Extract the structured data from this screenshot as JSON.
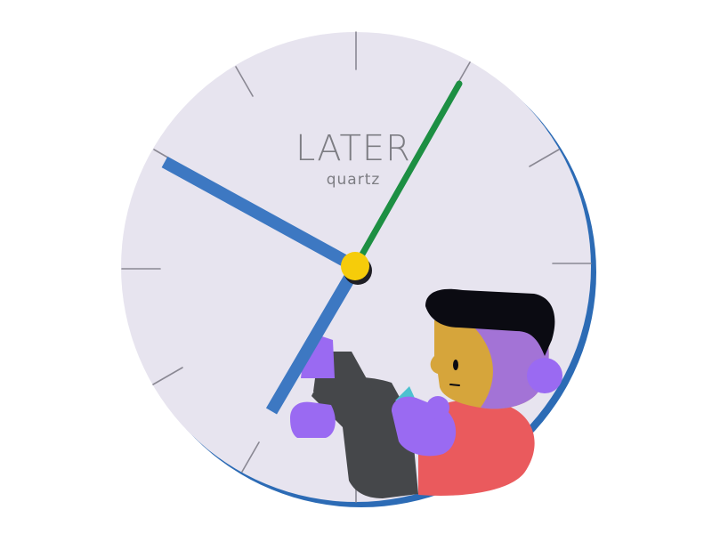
{
  "clock": {
    "brand": "LATER",
    "subtitle": "quartz"
  },
  "colors": {
    "face": "#e7e4ef",
    "rim_shadow": "#2c6bb5",
    "ticks": "#8a8893",
    "hour_minute_hands": "#3d78c2",
    "second_hand": "#1d8f43",
    "center_pin": "#f6cc0a",
    "brand_text": "#7d7d83",
    "hair": "#0b0b12",
    "skin": "#d6a53b",
    "hands_feet": "#9a6af2",
    "shirt": "#ea5a5d",
    "pants": "#45474a",
    "phone": "#4dc1d0"
  },
  "icons": {
    "character": "person-playing-phone-icon"
  }
}
